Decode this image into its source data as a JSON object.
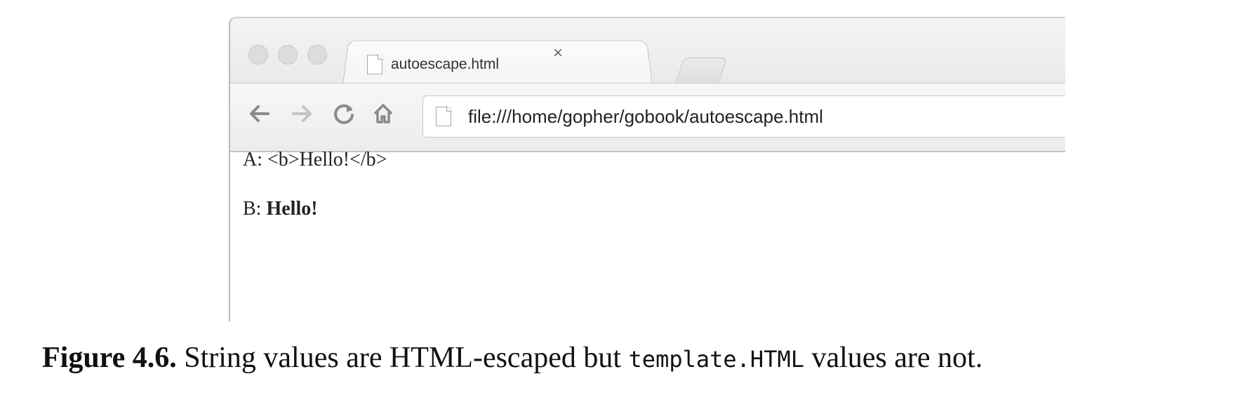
{
  "browser": {
    "tab": {
      "title": "autoescape.html",
      "close_glyph": "×"
    },
    "toolbar": {
      "back_icon": "back-arrow-icon",
      "forward_icon": "forward-arrow-icon",
      "reload_icon": "reload-icon",
      "home_icon": "home-icon",
      "address": "file:///home/gopher/gobook/autoescape.html"
    },
    "page": {
      "line_a_prefix": "A: ",
      "line_a_text": "<b>Hello!</b>",
      "line_b_prefix": "B: ",
      "line_b_bold": "Hello!"
    }
  },
  "caption": {
    "figure_label": "Figure 4.6.",
    "text_before": "String values are HTML-escaped but",
    "code": "template.HTML",
    "text_after": "values are not."
  }
}
